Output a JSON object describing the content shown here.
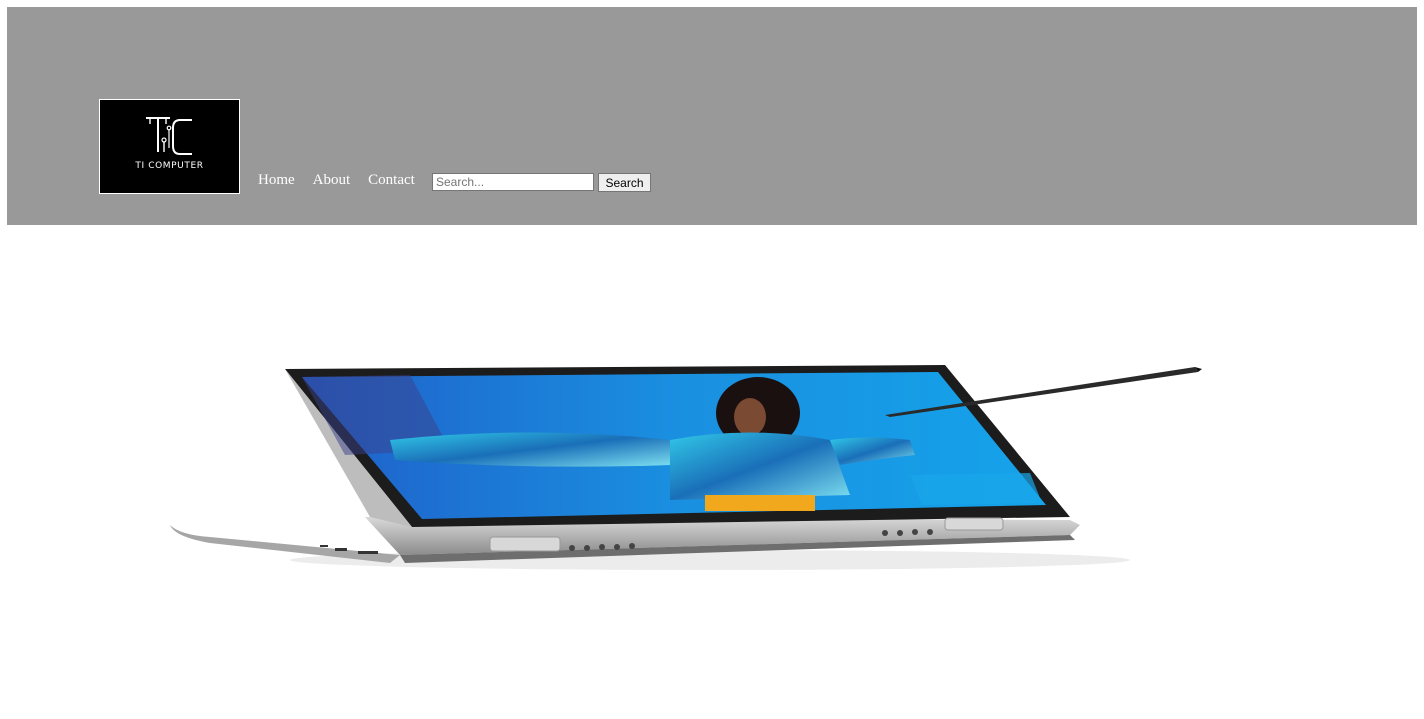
{
  "header": {
    "logo": {
      "monogram": "TC",
      "text": "TI COMPUTER"
    },
    "nav": [
      {
        "label": "Home"
      },
      {
        "label": "About"
      },
      {
        "label": "Contact"
      }
    ],
    "search": {
      "placeholder": "Search...",
      "value": "",
      "button_label": "Search"
    }
  },
  "hero": {
    "image": "convertible-laptop-with-stylus"
  },
  "colors": {
    "header_bg": "#999999",
    "page_bg": "#ffffff",
    "nav_text": "#ffffff",
    "logo_bg": "#000000"
  }
}
